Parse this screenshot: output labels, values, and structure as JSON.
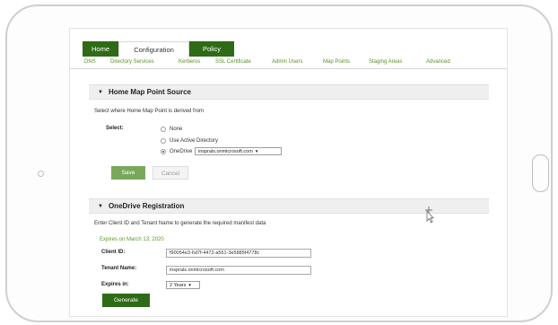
{
  "tabs": {
    "home": "Home",
    "configuration": "Configuration",
    "policy": "Policy"
  },
  "subnav": [
    "DNS",
    "Directory Services",
    "Kerberos",
    "SSL Certificate",
    "Admin Users",
    "Map Points",
    "Staging Areas",
    "Advanced"
  ],
  "home_map_point": {
    "title": "Home Map Point Source",
    "description": "Select where Home Map Point is derived from",
    "select_label": "Select:",
    "options": [
      "None",
      "Use Active Directory",
      "OneDrive"
    ],
    "selected_option": "OneDrive",
    "onedrive_value": "insprals.onmicrosoft.com",
    "save_label": "Save",
    "cancel_label": "Cancel"
  },
  "onedrive_registration": {
    "title": "OneDrive Registration",
    "description": "Enter Client ID and Tenant Name to generate the required manifest data",
    "expires_on": "Expires on March 13, 2020",
    "client_id_label": "Client ID:",
    "client_id_value": "f90054e3-6d7f-4472-a561-3e5885f4778c",
    "tenant_name_label": "Tenant Name:",
    "tenant_name_value": "insprals.onmicrosoft.com",
    "expires_in_label": "Expires in:",
    "expires_in_value": "2 Years",
    "generate_label": "Generate"
  },
  "colors": {
    "brand_green": "#2f6b16",
    "link_green": "#5a8f2a",
    "save_green": "#7aa85a"
  }
}
